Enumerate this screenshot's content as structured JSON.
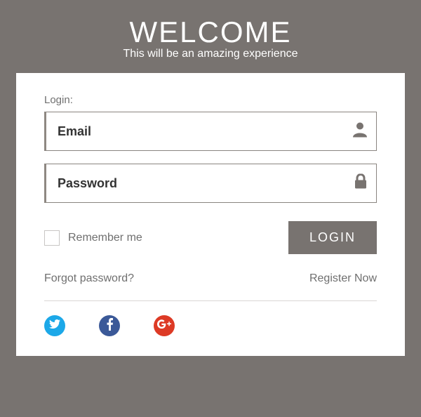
{
  "header": {
    "title": "WELCOME",
    "subtitle": "This will be an amazing experience"
  },
  "form": {
    "login_section_label": "Login:",
    "email_placeholder": "Email",
    "email_value": "",
    "password_placeholder": "Password",
    "password_value": "",
    "remember_label": "Remember me",
    "login_button_label": "LOGIN"
  },
  "links": {
    "forgot_label": "Forgot password?",
    "register_label": "Register Now"
  },
  "icons": {
    "user": "user-icon",
    "lock": "lock-icon",
    "twitter": "twitter-icon",
    "facebook": "facebook-icon",
    "gplus": "google-plus-icon"
  },
  "colors": {
    "accent_bg": "#787370",
    "twitter": "#1ca8e8",
    "facebook": "#3b5998",
    "gplus": "#dd3a25"
  }
}
